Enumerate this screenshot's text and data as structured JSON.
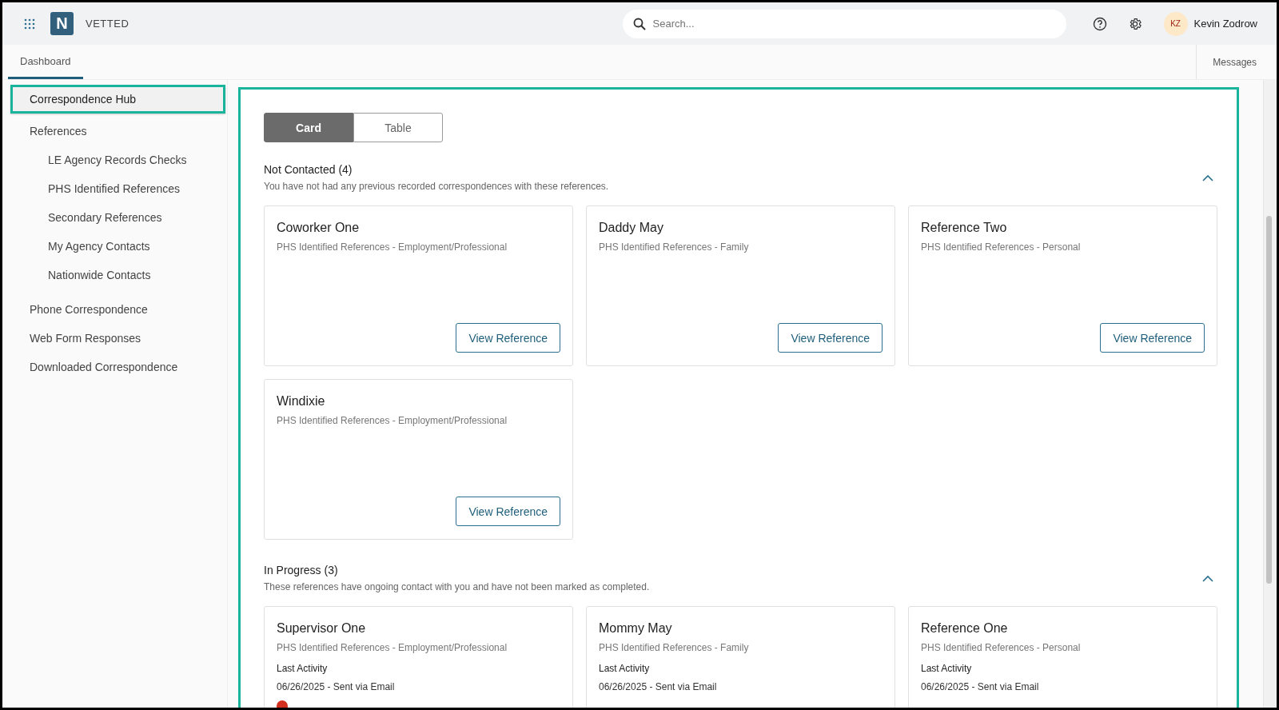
{
  "app": {
    "logo_letter": "N",
    "name": "VETTED"
  },
  "search": {
    "placeholder": "Search..."
  },
  "user": {
    "initials": "KZ",
    "name": "Kevin Zodrow"
  },
  "tabs": [
    {
      "label": "Dashboard",
      "selected": true
    }
  ],
  "right_tab": {
    "label": "Messages"
  },
  "sidebar": {
    "items": [
      {
        "label": "Correspondence Hub",
        "selected": true
      },
      {
        "label": "References",
        "selected": false,
        "children": [
          {
            "label": "LE Agency Records Checks",
            "selected": false
          },
          {
            "label": "PHS Identified References",
            "selected": false
          },
          {
            "label": "Secondary References",
            "selected": false
          },
          {
            "label": "My Agency Contacts",
            "selected": false
          },
          {
            "label": "Nationwide Contacts",
            "selected": false
          }
        ]
      },
      {
        "label": "Phone Correspondence",
        "selected": false
      },
      {
        "label": "Web Form Responses",
        "selected": false
      },
      {
        "label": "Downloaded Correspondence",
        "selected": false
      }
    ]
  },
  "view_toggle": [
    {
      "label": "Card",
      "selected": true
    },
    {
      "label": "Table",
      "selected": false
    }
  ],
  "sections": [
    {
      "title": "Not Contacted (4)",
      "description": "You have not had any previous recorded correspondences with these references.",
      "expanded": true,
      "cards": [
        {
          "name": "Coworker One",
          "category": "PHS Identified References - Employment/Professional",
          "button": "View Reference"
        },
        {
          "name": "Daddy May",
          "category": "PHS Identified References - Family",
          "button": "View Reference"
        },
        {
          "name": "Reference Two",
          "category": "PHS Identified References - Personal",
          "button": "View Reference"
        },
        {
          "name": "Windixie",
          "category": "PHS Identified References - Employment/Professional",
          "button": "View Reference"
        }
      ]
    },
    {
      "title": "In Progress (3)",
      "description": "These references have ongoing contact with you and have not been marked as completed.",
      "expanded": true,
      "cards": [
        {
          "name": "Supervisor One",
          "category": "PHS Identified References - Employment/Professional",
          "activity_label": "Last Activity",
          "activity": "06/26/2025 - Sent via Email",
          "alert": true
        },
        {
          "name": "Mommy May",
          "category": "PHS Identified References - Family",
          "activity_label": "Last Activity",
          "activity": "06/26/2025 - Sent via Email",
          "alert": false
        },
        {
          "name": "Reference One",
          "category": "PHS Identified References - Personal",
          "activity_label": "Last Activity",
          "activity": "06/26/2025 - Sent via Email",
          "alert": false
        }
      ]
    }
  ]
}
